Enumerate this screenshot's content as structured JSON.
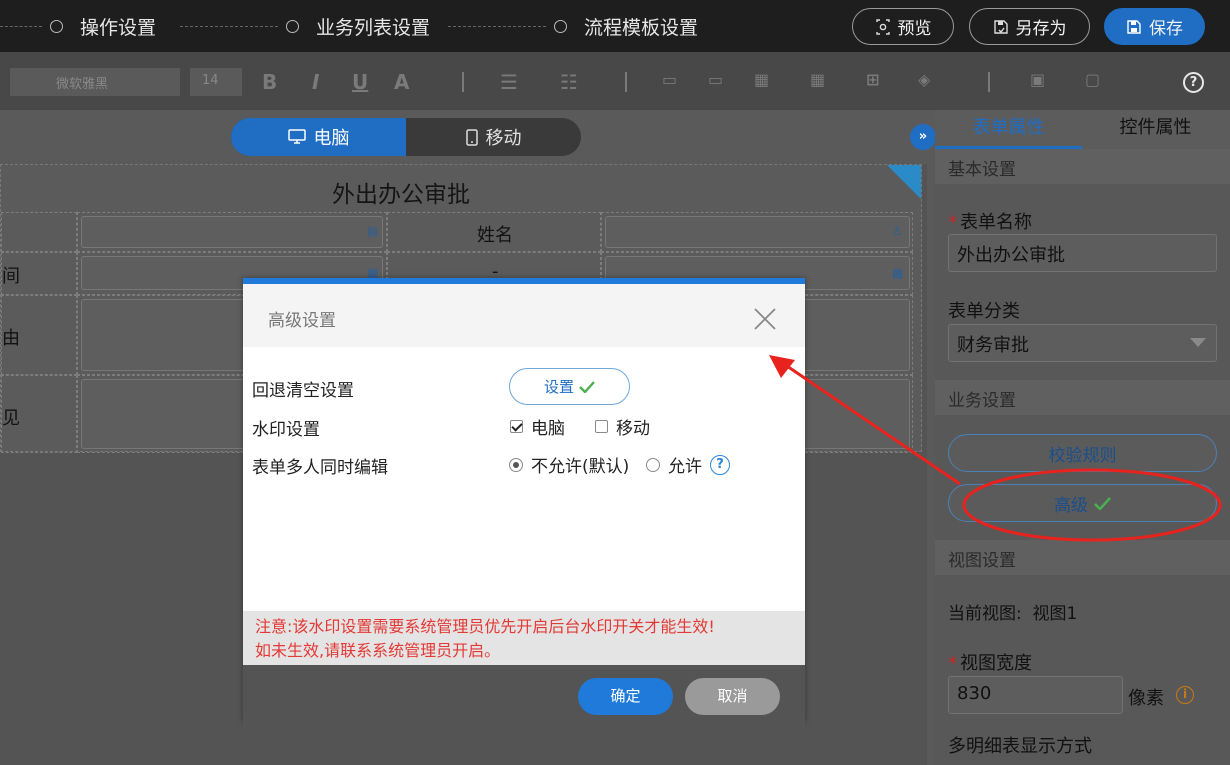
{
  "steps": [
    "操作设置",
    "业务列表设置",
    "流程模板设置"
  ],
  "top_buttons": {
    "preview": "预览",
    "save_as": "另存为",
    "save": "保存"
  },
  "toolbar": {
    "font": "微软雅黑",
    "size": "14"
  },
  "device": {
    "pc": "电脑",
    "mobile": "移动"
  },
  "form": {
    "title": "外出办公审批",
    "name_label": "姓名",
    "time_label": "间",
    "reason_label": "由",
    "opinion_label": "见",
    "dash": "-"
  },
  "panel": {
    "tabs": [
      "表单属性",
      "控件属性"
    ],
    "sections": {
      "basic": "基本设置",
      "business": "业务设置",
      "view": "视图设置"
    },
    "form_name_label": "表单名称",
    "form_name_value": "外出办公审批",
    "category_label": "表单分类",
    "category_value": "财务审批",
    "validate_button": "校验规则",
    "advanced_button": "高级",
    "current_view_label": "当前视图:",
    "current_view_value": "视图1",
    "view_width_label": "视图宽度",
    "view_width_value": "830",
    "view_width_unit": "像素",
    "multi_detail_label": "多明细表显示方式"
  },
  "modal": {
    "title": "高级设置",
    "rollback_label": "回退清空设置",
    "rollback_button": "设置",
    "watermark_label": "水印设置",
    "watermark_pc": "电脑",
    "watermark_pc_checked": true,
    "watermark_mobile": "移动",
    "watermark_mobile_checked": false,
    "multi_edit_label": "表单多人同时编辑",
    "multi_edit_disallow": "不允许(默认)",
    "multi_edit_allow": "允许",
    "multi_edit_selected": "不允许(默认)",
    "note_line1": "注意:该水印设置需要系统管理员优先开启后台水印开关才能生效!",
    "note_line2": "如未生效,请联系系统管理员开启。",
    "ok": "确定",
    "cancel": "取消"
  },
  "colors": {
    "accent": "#1f6ec4",
    "modal_accent": "#1f7ad9",
    "warning_text": "#e53935",
    "annotation": "#e8231d",
    "check": "#4caf50"
  }
}
